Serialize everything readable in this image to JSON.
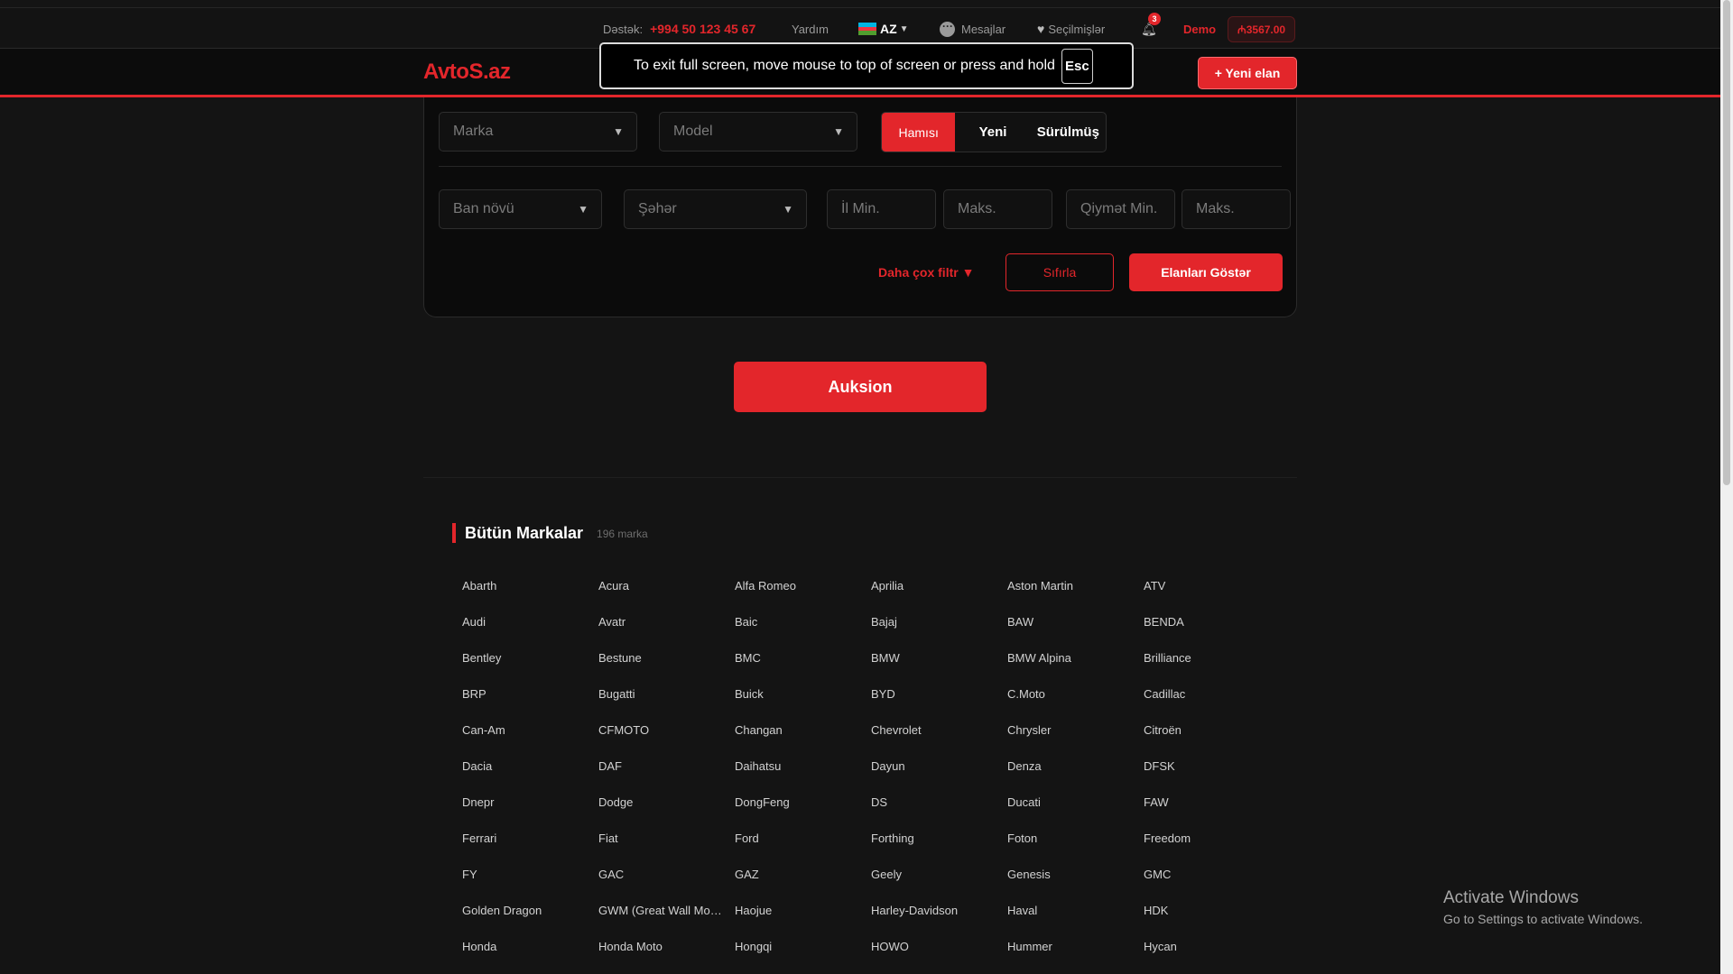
{
  "topbar": {
    "support_label": "Dəstək:",
    "support_phone": "+994 50 123 45 67",
    "help": "Yardım",
    "lang": "AZ",
    "messages": "Mesajlar",
    "favorites": "Seçilmişlər",
    "notif_count": "3",
    "user": "Demo",
    "balance": "₼3567.00"
  },
  "header": {
    "logo": "AvtoS.az",
    "new_ad": "+ Yeni elan"
  },
  "fullscreen_toast": {
    "text": "To exit full screen, move mouse to top of screen or press and hold",
    "key": "Esc"
  },
  "search": {
    "brand_placeholder": "Marka",
    "model_placeholder": "Model",
    "condition_tabs": [
      "Hamısı",
      "Yeni",
      "Sürülmüş"
    ],
    "body_placeholder": "Ban növü",
    "city_placeholder": "Şəhər",
    "year_min": "İl Min.",
    "year_max": "Maks.",
    "price_min": "Qiymət Min.",
    "price_max": "Maks.",
    "more_filters": "Daha çox filtr",
    "reset": "Sıfırla",
    "show": "Elanları Göstər"
  },
  "auction_button": "Auksion",
  "brands": {
    "title": "Bütün Markalar",
    "count": "196 marka",
    "items": [
      "Abarth",
      "Acura",
      "Alfa Romeo",
      "Aprilia",
      "Aston Martin",
      "ATV",
      "Audi",
      "Avatr",
      "Baic",
      "Bajaj",
      "BAW",
      "BENDA",
      "Bentley",
      "Bestune",
      "BMC",
      "BMW",
      "BMW Alpina",
      "Brilliance",
      "BRP",
      "Bugatti",
      "Buick",
      "BYD",
      "C.Moto",
      "Cadillac",
      "Can-Am",
      "CFMOTO",
      "Changan",
      "Chevrolet",
      "Chrysler",
      "Citroën",
      "Dacia",
      "DAF",
      "Daihatsu",
      "Dayun",
      "Denza",
      "DFSK",
      "Dnepr",
      "Dodge",
      "DongFeng",
      "DS",
      "Ducati",
      "FAW",
      "Ferrari",
      "Fiat",
      "Ford",
      "Forthing",
      "Foton",
      "Freedom",
      "FY",
      "GAC",
      "GAZ",
      "Geely",
      "Genesis",
      "GMC",
      "Golden Dragon",
      "GWM (Great Wall Motors)",
      "Haojue",
      "Harley-Davidson",
      "Haval",
      "HDK",
      "Honda",
      "Honda Moto",
      "Hongqi",
      "HOWO",
      "Hummer",
      "Hycan"
    ]
  },
  "windows_watermark": {
    "line1": "Activate Windows",
    "line2": "Go to Settings to activate Windows."
  },
  "colors": {
    "accent": "#e3262b",
    "background": "#141414",
    "card": "#0b0b0b"
  }
}
